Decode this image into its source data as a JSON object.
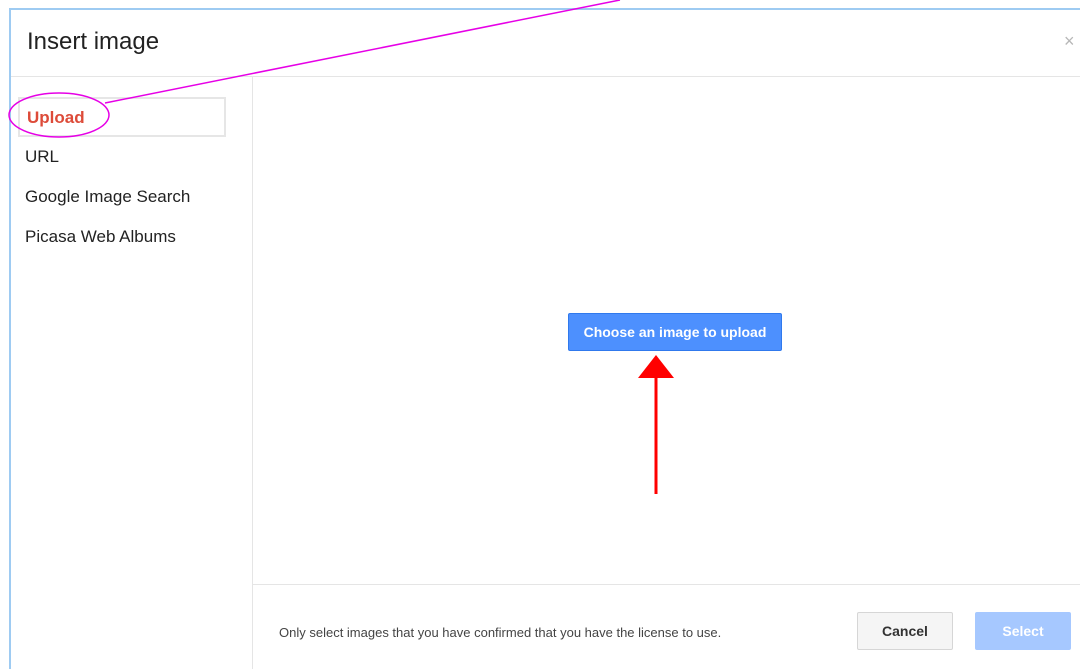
{
  "dialog": {
    "title": "Insert image",
    "close_label": "×"
  },
  "sidebar": {
    "items": [
      {
        "label": "Upload",
        "selected": true
      },
      {
        "label": "URL",
        "selected": false
      },
      {
        "label": "Google Image Search",
        "selected": false
      },
      {
        "label": "Picasa Web Albums",
        "selected": false
      }
    ]
  },
  "main": {
    "upload_button_label": "Choose an image to upload"
  },
  "footer": {
    "license_note": "Only select images that you have confirmed that you have the license to use.",
    "cancel_label": "Cancel",
    "select_label": "Select"
  },
  "colors": {
    "selected_item": "#dd4b39",
    "primary_button": "#4d90fe",
    "disabled_button": "#a6c8ff",
    "annotation_circle": "#e600e6",
    "annotation_arrow": "#ff0000"
  },
  "icons": {
    "close": "close-icon"
  }
}
